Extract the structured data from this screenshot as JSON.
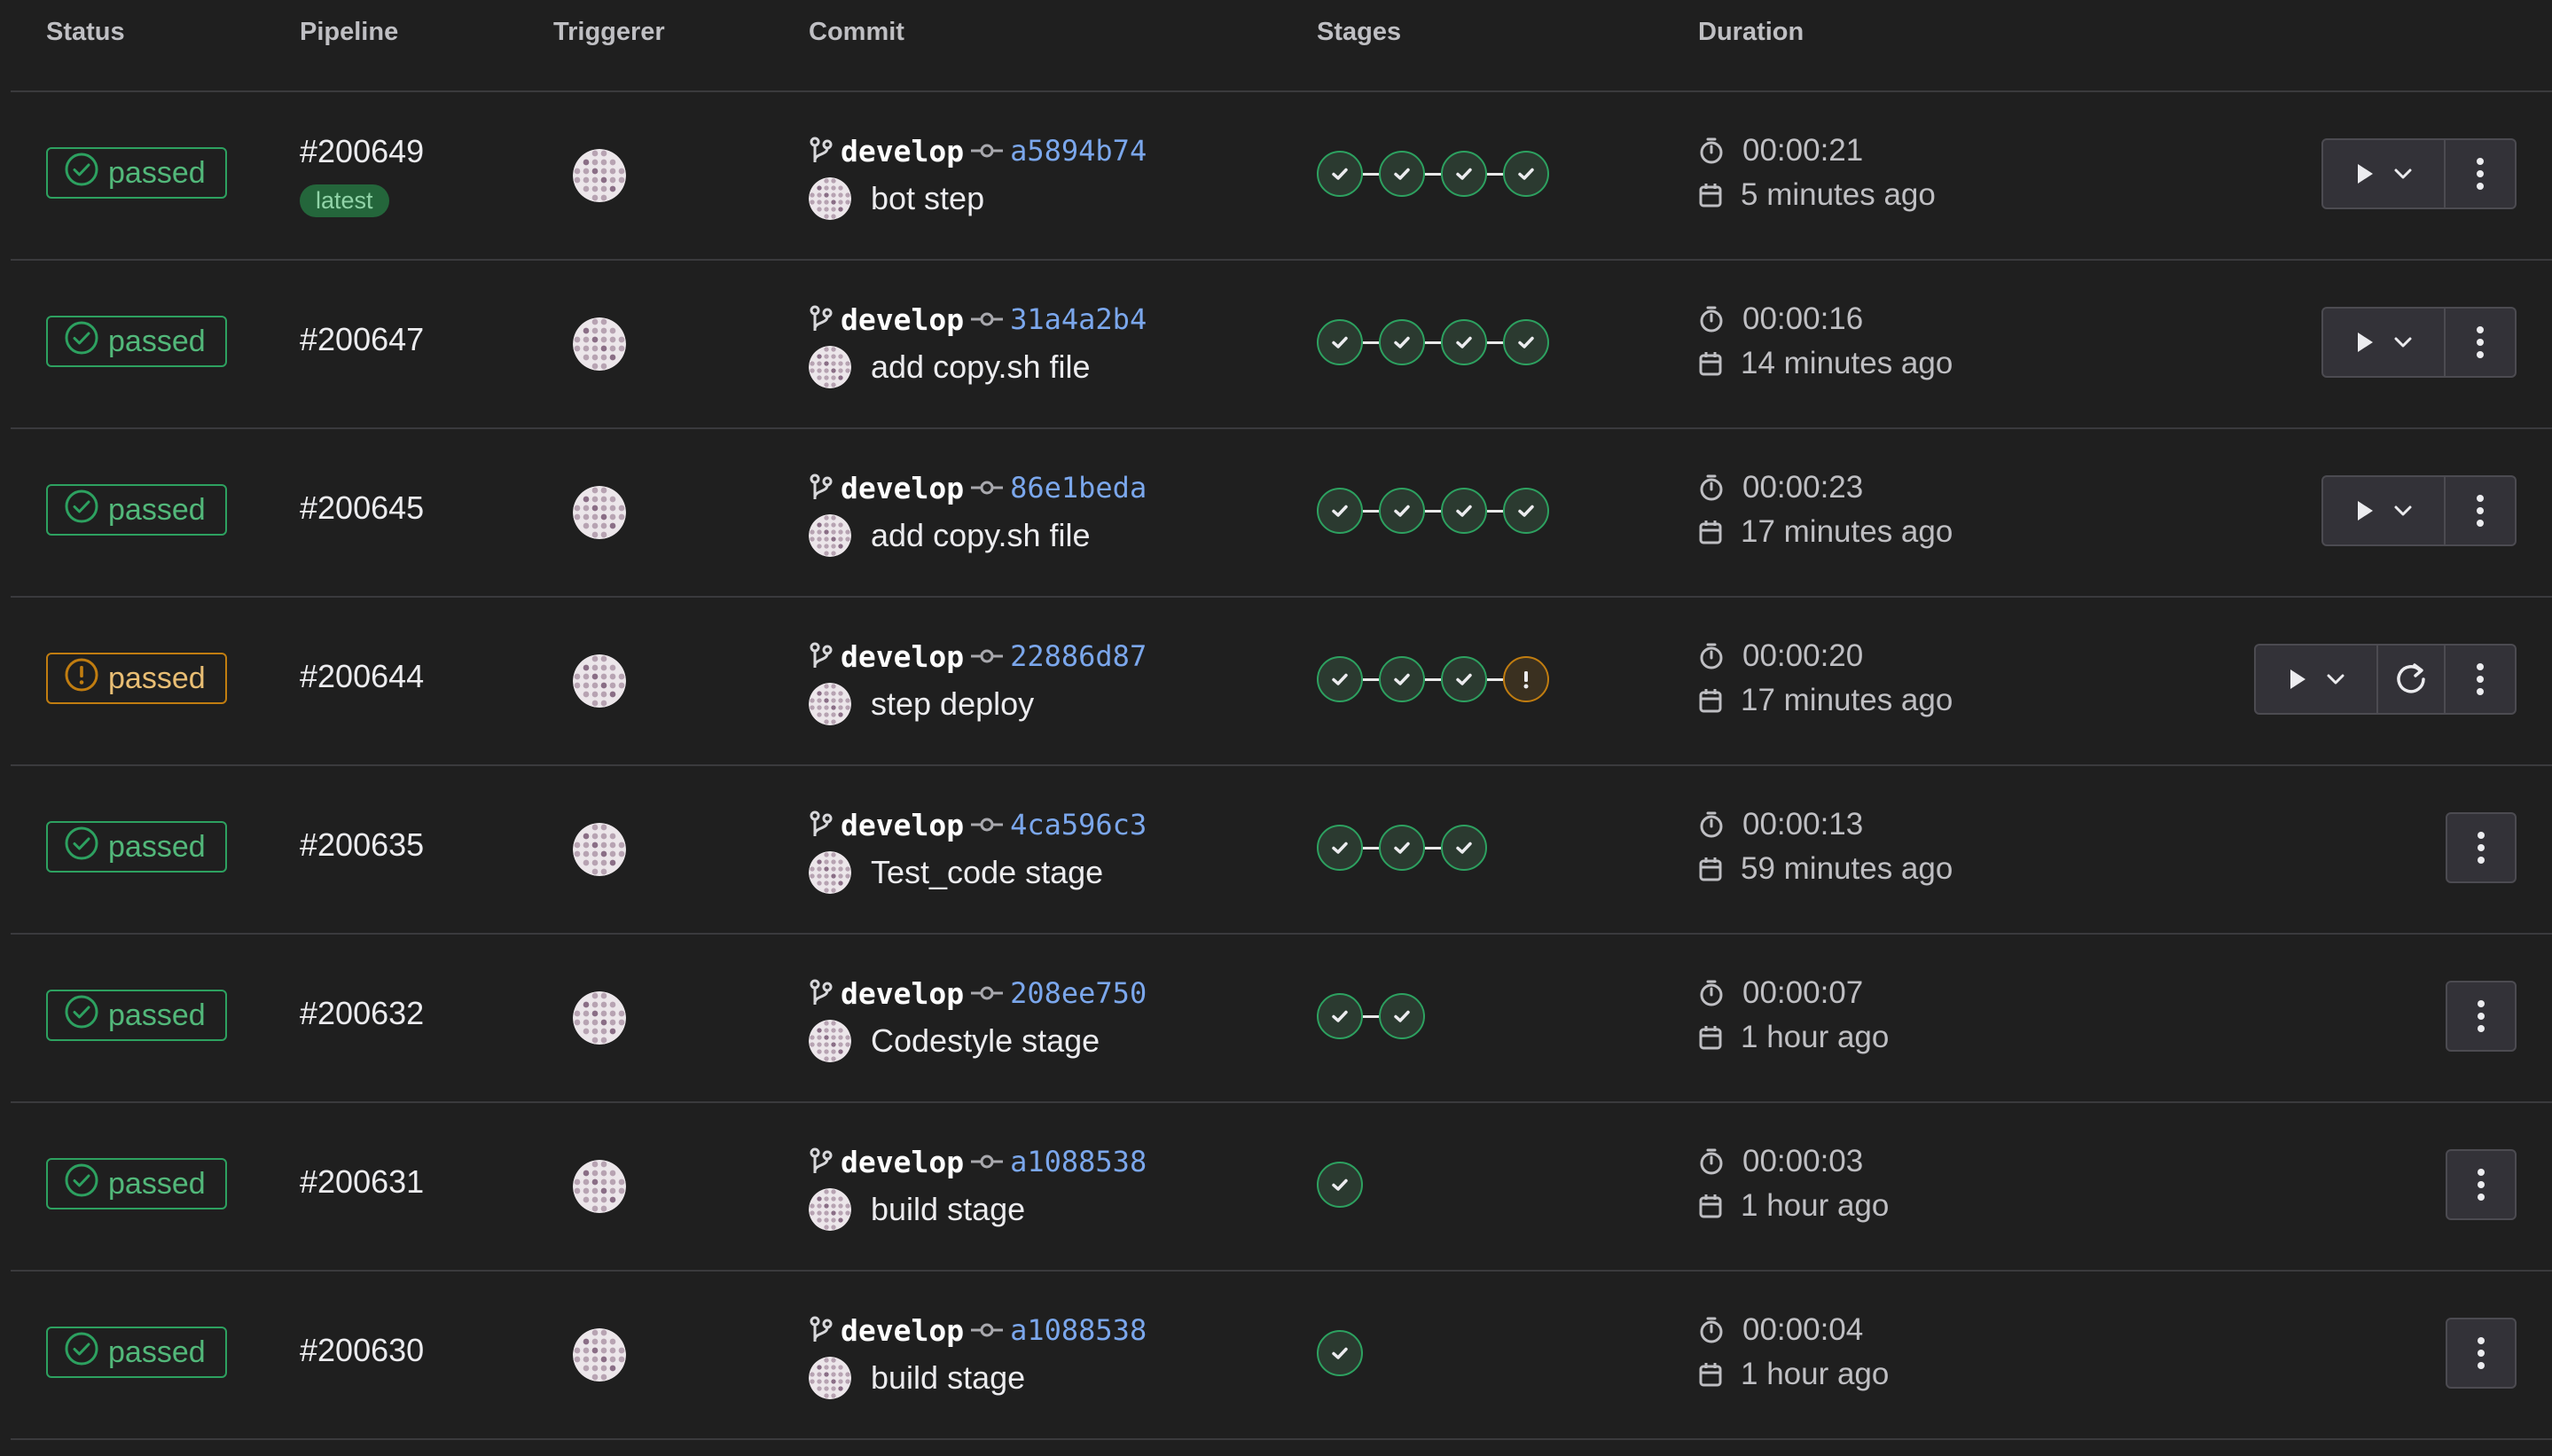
{
  "headers": {
    "status": "Status",
    "pipeline": "Pipeline",
    "triggerer": "Triggerer",
    "commit": "Commit",
    "stages": "Stages",
    "duration": "Duration"
  },
  "colors": {
    "success": "#2da160",
    "warning": "#c17d10",
    "sha_link": "#7ba7ec",
    "latest_badge_bg": "#24663b"
  },
  "icons": {
    "status_passed": "check-circle-icon",
    "status_warning": "exclamation-circle-icon",
    "branch": "branch-icon",
    "commit": "commit-icon",
    "duration": "timer-icon",
    "date": "calendar-icon",
    "run": "play-icon",
    "dropdown": "chevron-down-icon",
    "retry": "retry-icon",
    "more": "kebab-menu-icon"
  },
  "rows": [
    {
      "status": "passed",
      "status_kind": "success",
      "id": "#200649",
      "badge": "latest",
      "branch": "develop",
      "sha": "a5894b74",
      "message": "bot step",
      "stages": [
        "success",
        "success",
        "success",
        "success"
      ],
      "duration": "00:00:21",
      "finished": "5 minutes ago",
      "actions": [
        "run",
        "more"
      ]
    },
    {
      "status": "passed",
      "status_kind": "success",
      "id": "#200647",
      "badge": "",
      "branch": "develop",
      "sha": "31a4a2b4",
      "message": "add copy.sh file",
      "stages": [
        "success",
        "success",
        "success",
        "success"
      ],
      "duration": "00:00:16",
      "finished": "14 minutes ago",
      "actions": [
        "run",
        "more"
      ]
    },
    {
      "status": "passed",
      "status_kind": "success",
      "id": "#200645",
      "badge": "",
      "branch": "develop",
      "sha": "86e1beda",
      "message": "add copy.sh file",
      "stages": [
        "success",
        "success",
        "success",
        "success"
      ],
      "duration": "00:00:23",
      "finished": "17 minutes ago",
      "actions": [
        "run",
        "more"
      ]
    },
    {
      "status": "passed",
      "status_kind": "warning",
      "id": "#200644",
      "badge": "",
      "branch": "develop",
      "sha": "22886d87",
      "message": "step deploy",
      "stages": [
        "success",
        "success",
        "success",
        "warning"
      ],
      "duration": "00:00:20",
      "finished": "17 minutes ago",
      "actions": [
        "run",
        "retry",
        "more"
      ]
    },
    {
      "status": "passed",
      "status_kind": "success",
      "id": "#200635",
      "badge": "",
      "branch": "develop",
      "sha": "4ca596c3",
      "message": "Test_code stage",
      "stages": [
        "success",
        "success",
        "success"
      ],
      "duration": "00:00:13",
      "finished": "59 minutes ago",
      "actions": [
        "more"
      ]
    },
    {
      "status": "passed",
      "status_kind": "success",
      "id": "#200632",
      "badge": "",
      "branch": "develop",
      "sha": "208ee750",
      "message": "Codestyle stage",
      "stages": [
        "success",
        "success"
      ],
      "duration": "00:00:07",
      "finished": "1 hour ago",
      "actions": [
        "more"
      ]
    },
    {
      "status": "passed",
      "status_kind": "success",
      "id": "#200631",
      "badge": "",
      "branch": "develop",
      "sha": "a1088538",
      "message": "build stage",
      "stages": [
        "success"
      ],
      "duration": "00:00:03",
      "finished": "1 hour ago",
      "actions": [
        "more"
      ]
    },
    {
      "status": "passed",
      "status_kind": "success",
      "id": "#200630",
      "badge": "",
      "branch": "develop",
      "sha": "a1088538",
      "message": "build stage",
      "stages": [
        "success"
      ],
      "duration": "00:00:04",
      "finished": "1 hour ago",
      "actions": [
        "more"
      ]
    }
  ]
}
